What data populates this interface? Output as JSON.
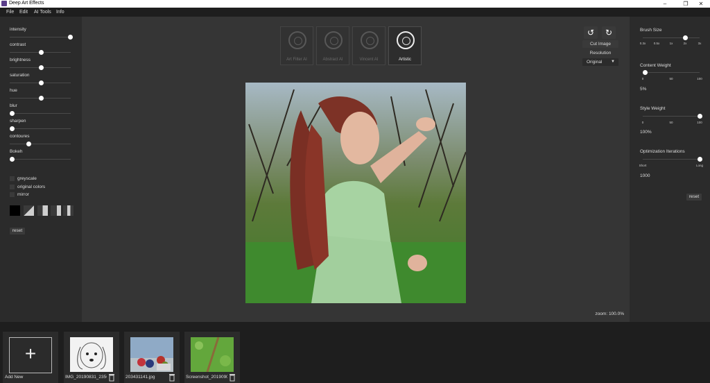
{
  "window": {
    "title": "Deep Art Effects",
    "controls": [
      "–",
      "❐",
      "✕"
    ]
  },
  "menu": [
    "File",
    "Edit",
    "AI Tools",
    "Info"
  ],
  "left_panel": {
    "sliders": [
      {
        "label": "intensity",
        "value": 1.0
      },
      {
        "label": "contrast",
        "value": 0.5
      },
      {
        "label": "brightness",
        "value": 0.5
      },
      {
        "label": "saturation",
        "value": 0.5
      },
      {
        "label": "hue",
        "value": 0.5
      },
      {
        "label": "blur",
        "value": 0.0
      },
      {
        "label": "sharpen",
        "value": 0.0
      },
      {
        "label": "contoures",
        "value": 0.28
      },
      {
        "label": "Bokeh",
        "value": 0.0
      }
    ],
    "checkboxes": [
      "greyscale",
      "original colors",
      "mirror"
    ],
    "reset_label": "reset"
  },
  "styles": [
    {
      "label": "Art Filter AI",
      "active": false
    },
    {
      "label": "Abstract AI",
      "active": false
    },
    {
      "label": "Vincent AI",
      "active": false
    },
    {
      "label": "Artistic",
      "active": true
    }
  ],
  "top_right_controls": {
    "rotate_left": "↺",
    "rotate_right": "↻",
    "cut_image": "Cut Image",
    "resolution_label": "Resolution",
    "resolution_value": "Original"
  },
  "zoom_text": "zoom: 100.0%",
  "right_panel": {
    "brush_size": {
      "label": "Brush Size",
      "ticks": [
        "0.3x",
        "0.5x",
        "1x",
        "2x",
        "3x"
      ],
      "value": 0.75
    },
    "content_weight": {
      "label": "Content Weight",
      "ticks": [
        "0",
        "50",
        "100"
      ],
      "value": 0.0,
      "readout": "5%"
    },
    "style_weight": {
      "label": "Style Weight",
      "ticks": [
        "0",
        "50",
        "100"
      ],
      "value": 1.0,
      "readout": "100%"
    },
    "optimization": {
      "label": "Optimization Iterations",
      "ticks": [
        "Short",
        "Long"
      ],
      "value": 1.0,
      "readout": "1000"
    },
    "reset_label": "reset"
  },
  "thumbnails": [
    {
      "name": "Add New",
      "type": "add"
    },
    {
      "name": "IMG_20190831_2356",
      "type": "sketch"
    },
    {
      "name": "203431141.jpg",
      "type": "fruit"
    },
    {
      "name": "Screenshot_2019090",
      "type": "green"
    }
  ]
}
